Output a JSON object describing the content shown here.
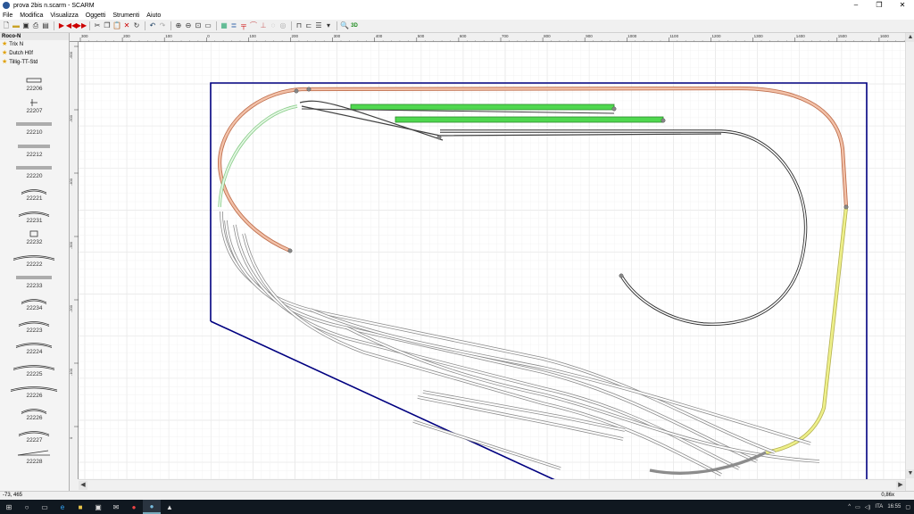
{
  "window": {
    "title": "prova 2bis n.scarm - SCARM"
  },
  "window_buttons": {
    "minimize": "–",
    "maximize": "❐",
    "close": "✕"
  },
  "menu": [
    "File",
    "Modifica",
    "Visualizza",
    "Oggetti",
    "Strumenti",
    "Aiuto"
  ],
  "sidebar": {
    "header": "Roco-N",
    "options": [
      "Trix N",
      "Dutch H0f",
      "Tillig-TT-Std"
    ],
    "items": [
      "22206",
      "22207",
      "22210",
      "22212",
      "22220",
      "22221",
      "22231",
      "22232",
      "22222",
      "22233",
      "22234",
      "22223",
      "22224",
      "22225",
      "22226",
      "22226",
      "22227",
      "22228"
    ]
  },
  "ruler": {
    "top_labels": [
      "300",
      "200",
      "100",
      "0",
      "100",
      "200",
      "300",
      "400",
      "500",
      "600",
      "700",
      "800",
      "900",
      "1000",
      "1100",
      "1200",
      "1300",
      "1400",
      "1500",
      "1600"
    ],
    "left_labels": [
      "-600",
      "-500",
      "-400",
      "-300",
      "-200",
      "-100",
      "0"
    ]
  },
  "statusbar": {
    "coords": "-73, 465",
    "zoom": "0,86x"
  },
  "taskbar": {
    "lang": "ITA",
    "time": "16:55"
  },
  "colors": {
    "frame": "#000080",
    "orange_track": "#d98a6a",
    "green_track": "#4fd84f",
    "yellow_track": "#eef08a",
    "gray_track": "#8c8c8c",
    "dark_track": "#404040"
  }
}
